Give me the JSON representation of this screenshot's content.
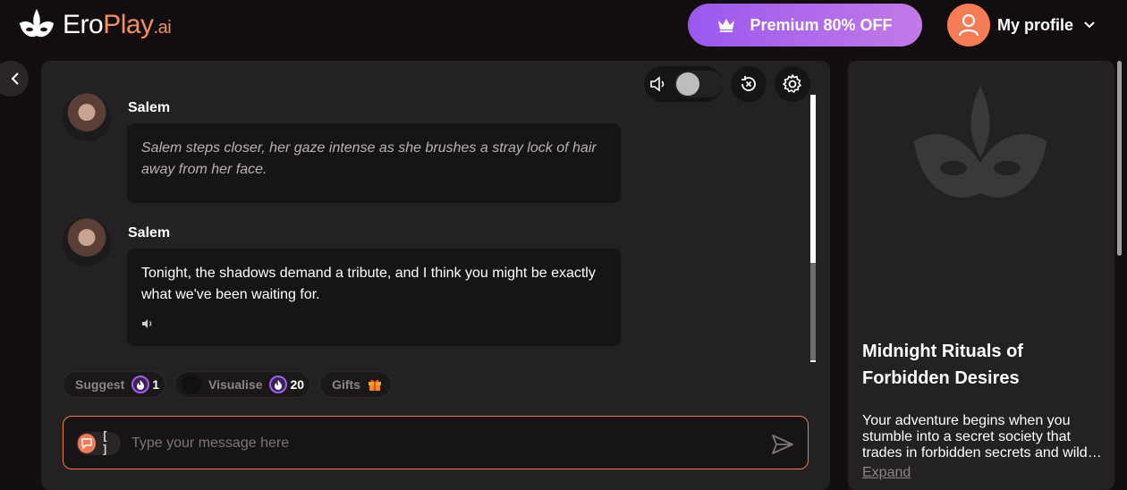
{
  "brand": {
    "name_part1": "Ero",
    "name_part2": "Play",
    "name_part3": ".ai"
  },
  "header": {
    "premium_label": "Premium 80% OFF",
    "profile_label": "My profile"
  },
  "chat": {
    "messages": [
      {
        "author": "Salem",
        "text": "Salem steps closer, her gaze intense as she brushes a stray lock of hair away from her face."
      },
      {
        "author": "Salem",
        "text": "Tonight, the shadows demand a tribute, and I think you might be exactly what we've been waiting for."
      }
    ],
    "actions": {
      "suggest_label": "Suggest",
      "suggest_cost": "1",
      "visualise_label": "Visualise",
      "visualise_cost": "20",
      "gifts_label": "Gifts"
    },
    "composer": {
      "mode_label": "[ ]",
      "placeholder": "Type your message here",
      "value": ""
    }
  },
  "story": {
    "title": "Midnight Rituals of Forbidden Desires",
    "description": "Your adventure begins when you stumble into a secret society that trades in forbidden secrets and wild desires.",
    "expand_label": "Expand"
  },
  "colors": {
    "accent": "#f58e5e",
    "premium_start": "#9a58ee",
    "premium_end": "#c27ae8",
    "composer_border": "#f07d52"
  }
}
